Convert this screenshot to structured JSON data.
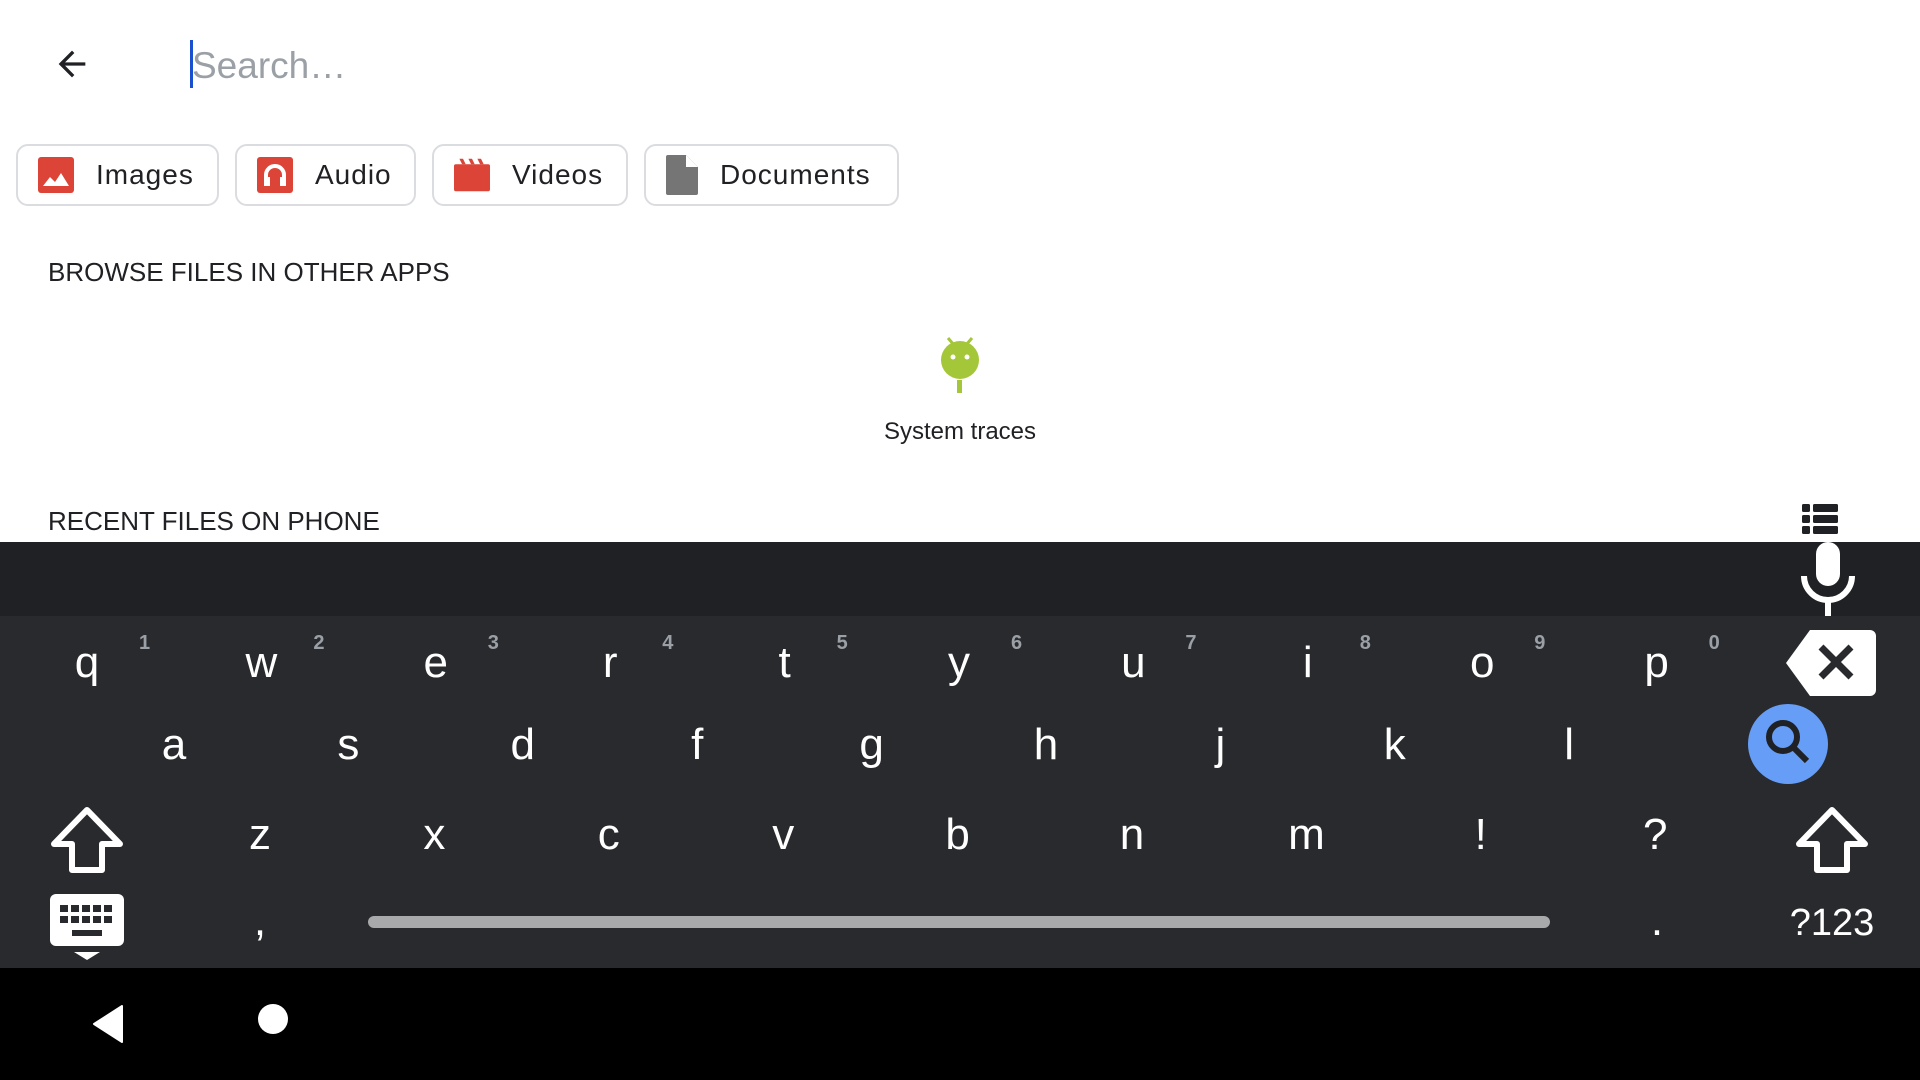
{
  "search": {
    "placeholder": "Search…",
    "value": ""
  },
  "icons": {
    "back": "arrow-left-icon"
  },
  "chips": [
    {
      "label": "Images",
      "icon": "image-icon",
      "color": "#db4437"
    },
    {
      "label": "Audio",
      "icon": "headphones-icon",
      "color": "#db4437"
    },
    {
      "label": "Videos",
      "icon": "clapperboard-icon",
      "color": "#db4437"
    },
    {
      "label": "Documents",
      "icon": "document-icon",
      "color": "#757575"
    }
  ],
  "browse": {
    "heading": "BROWSE FILES IN OTHER APPS",
    "apps": [
      {
        "label": "System traces",
        "icon": "android-icon",
        "color": "#a4c639"
      }
    ]
  },
  "recent": {
    "heading": "RECENT FILES ON PHONE",
    "view_toggle": "list-view-icon"
  },
  "keyboard": {
    "row1": [
      {
        "key": "q",
        "hint": "1"
      },
      {
        "key": "w",
        "hint": "2"
      },
      {
        "key": "e",
        "hint": "3"
      },
      {
        "key": "r",
        "hint": "4"
      },
      {
        "key": "t",
        "hint": "5"
      },
      {
        "key": "y",
        "hint": "6"
      },
      {
        "key": "u",
        "hint": "7"
      },
      {
        "key": "i",
        "hint": "8"
      },
      {
        "key": "o",
        "hint": "9"
      },
      {
        "key": "p",
        "hint": "0"
      }
    ],
    "row2": [
      "a",
      "s",
      "d",
      "f",
      "g",
      "h",
      "j",
      "k",
      "l"
    ],
    "row3": [
      "z",
      "x",
      "c",
      "v",
      "b",
      "n",
      "m",
      "!",
      "?"
    ],
    "row4": {
      "comma": ",",
      "period": ".",
      "symbols": "?123"
    },
    "action_color": "#669df6"
  },
  "nav": {
    "back": "nav-back-icon",
    "home": "nav-home-icon"
  }
}
